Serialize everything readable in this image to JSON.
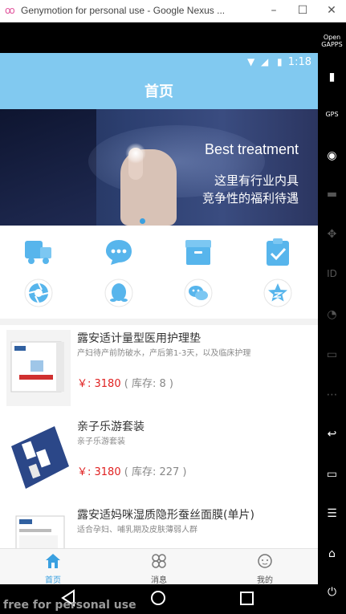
{
  "window": {
    "title": "Genymotion for personal use - Google Nexus ...",
    "logo": "oo"
  },
  "status": {
    "time": "1:18"
  },
  "appbar": {
    "title": "首页"
  },
  "banner": {
    "headline": "Best treatment",
    "line1": "这里有行业内具",
    "line2": "竞争性的福利待遇"
  },
  "icons": [
    "truck-icon",
    "chat-icon",
    "box-icon",
    "clipboard-check-icon",
    "shutter-icon",
    "qq-penguin-icon",
    "wechat-icon",
    "star-icon"
  ],
  "products": [
    {
      "name": "露安适计量型医用护理垫",
      "desc": "产妇待产前防破水，产后第1-3天，以及临床护理",
      "price": "￥: 3180",
      "stock": "( 库存: 8 )"
    },
    {
      "name": "亲子乐游套装",
      "desc": "亲子乐游套装",
      "price": "￥: 3180",
      "stock": "( 库存: 227 )"
    },
    {
      "name": "露安适妈咪湿质隐形蚕丝面膜(单片)",
      "desc": "适合孕妇、哺乳期及皮肤薄弱人群",
      "price": "",
      "stock": ""
    }
  ],
  "tabs": [
    {
      "label": "首页",
      "active": true
    },
    {
      "label": "消息",
      "active": false
    },
    {
      "label": "我的",
      "active": false
    }
  ],
  "side": {
    "opengapps": "Open GAPPS",
    "gps": "GPS",
    "id": "ID"
  },
  "watermark": "free for personal use",
  "colors": {
    "accent": "#81c9f0",
    "iconBlue": "#57b5ec",
    "price": "#e02020",
    "tabActive": "#3aa0e0"
  }
}
